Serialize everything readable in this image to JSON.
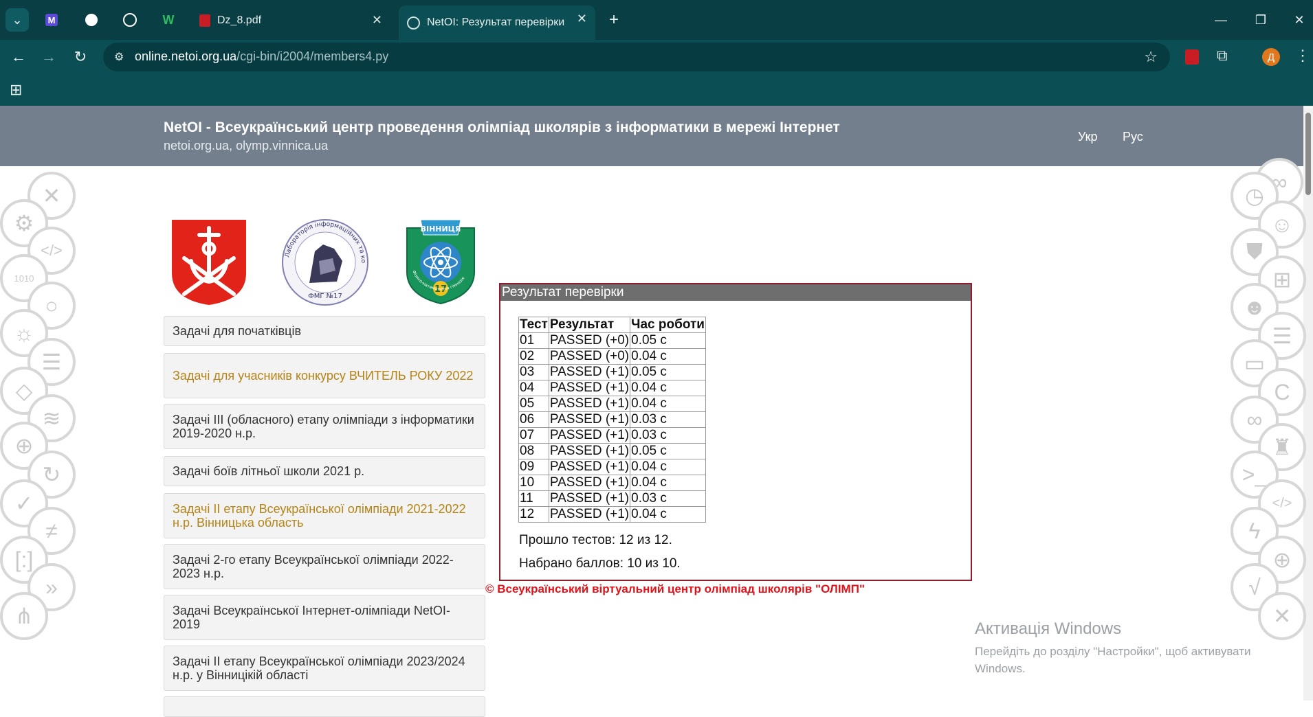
{
  "browser": {
    "tabs": [
      {
        "label": "Dz_8.pdf",
        "icon": "pdf-icon"
      },
      {
        "label": "NetOI: Результат перевірки",
        "icon": "globe-icon",
        "active": true
      }
    ],
    "address": {
      "host": "online.netoi.org.ua",
      "path": "/cgi-bin/i2004/members4.py"
    },
    "profile_initial": "Д"
  },
  "header": {
    "title": "NetOI - Всеукраїнський центр проведення олімпіад школярів з інформатики в мережі Інтернет",
    "subtitle": "netoi.org.ua, olymp.vinnica.ua",
    "lang_ukr": "Укр",
    "lang_rus": "Рус"
  },
  "logos": {
    "lab_top_text": "Лабораторія інформаційних та комунікаційних технологій",
    "lab_bottom_text": "ФМГ №17",
    "school_top_text": "ВІННИЦЯ",
    "school_number": "17",
    "school_bottom_text": "Фізико-математична гімназія"
  },
  "menu": [
    {
      "label": "Задачі для початківців",
      "highlight": false
    },
    {
      "label": "Задачі для учасників конкурсу ВЧИТЕЛЬ РОКУ 2022",
      "highlight": true
    },
    {
      "label": "Задачі III (обласного) етапу олімпіади з інформатики 2019-2020 н.р.",
      "highlight": false
    },
    {
      "label": "Задачі боїв літньої школи 2021 р.",
      "highlight": false
    },
    {
      "label": "Задачі II етапу Всеукраїнської олімпіади 2021-2022 н.р. Вінницька область",
      "highlight": true
    },
    {
      "label": "Задачі 2-го етапу Всеукраїнської олімпіади 2022-2023 н.р.",
      "highlight": false
    },
    {
      "label": "Задачі Всеукраїнської Інтернет-олімпіади NetOI-2019",
      "highlight": false
    },
    {
      "label": "Задачі II етапу Всеукраїнської олімпіади 2023/2024 н.р. у Вінницікій області",
      "highlight": false
    }
  ],
  "result": {
    "title": "Результат перевірки",
    "columns": [
      "Тест",
      "Результат",
      "Час роботи"
    ],
    "rows": [
      [
        "01",
        "PASSED (+0)",
        "0.05 с"
      ],
      [
        "02",
        "PASSED (+0)",
        "0.04 с"
      ],
      [
        "03",
        "PASSED (+1)",
        "0.05 с"
      ],
      [
        "04",
        "PASSED (+1)",
        "0.04 с"
      ],
      [
        "05",
        "PASSED (+1)",
        "0.04 с"
      ],
      [
        "06",
        "PASSED (+1)",
        "0.03 с"
      ],
      [
        "07",
        "PASSED (+1)",
        "0.03 с"
      ],
      [
        "08",
        "PASSED (+1)",
        "0.05 с"
      ],
      [
        "09",
        "PASSED (+1)",
        "0.04 с"
      ],
      [
        "10",
        "PASSED (+1)",
        "0.04 с"
      ],
      [
        "11",
        "PASSED (+1)",
        "0.03 с"
      ],
      [
        "12",
        "PASSED (+1)",
        "0.04 с"
      ]
    ],
    "tests_passed": "Прошло тестов: 12 из 12.",
    "score": "Набрано баллов: 10 из 10."
  },
  "copyright": "© Всеукраїнський віртуальний центр олімпіад школярів \"ОЛІМП\"",
  "activation": {
    "title": "Активація Windows",
    "text": "Перейдіть до розділу \"Настройки\", щоб активувати Windows."
  },
  "colors": {
    "chrome": "#0b4f54",
    "header": "#737f8c",
    "panel_border": "#8b1d2c",
    "highlight_link": "#b58415",
    "copyright": "#e0131a"
  }
}
